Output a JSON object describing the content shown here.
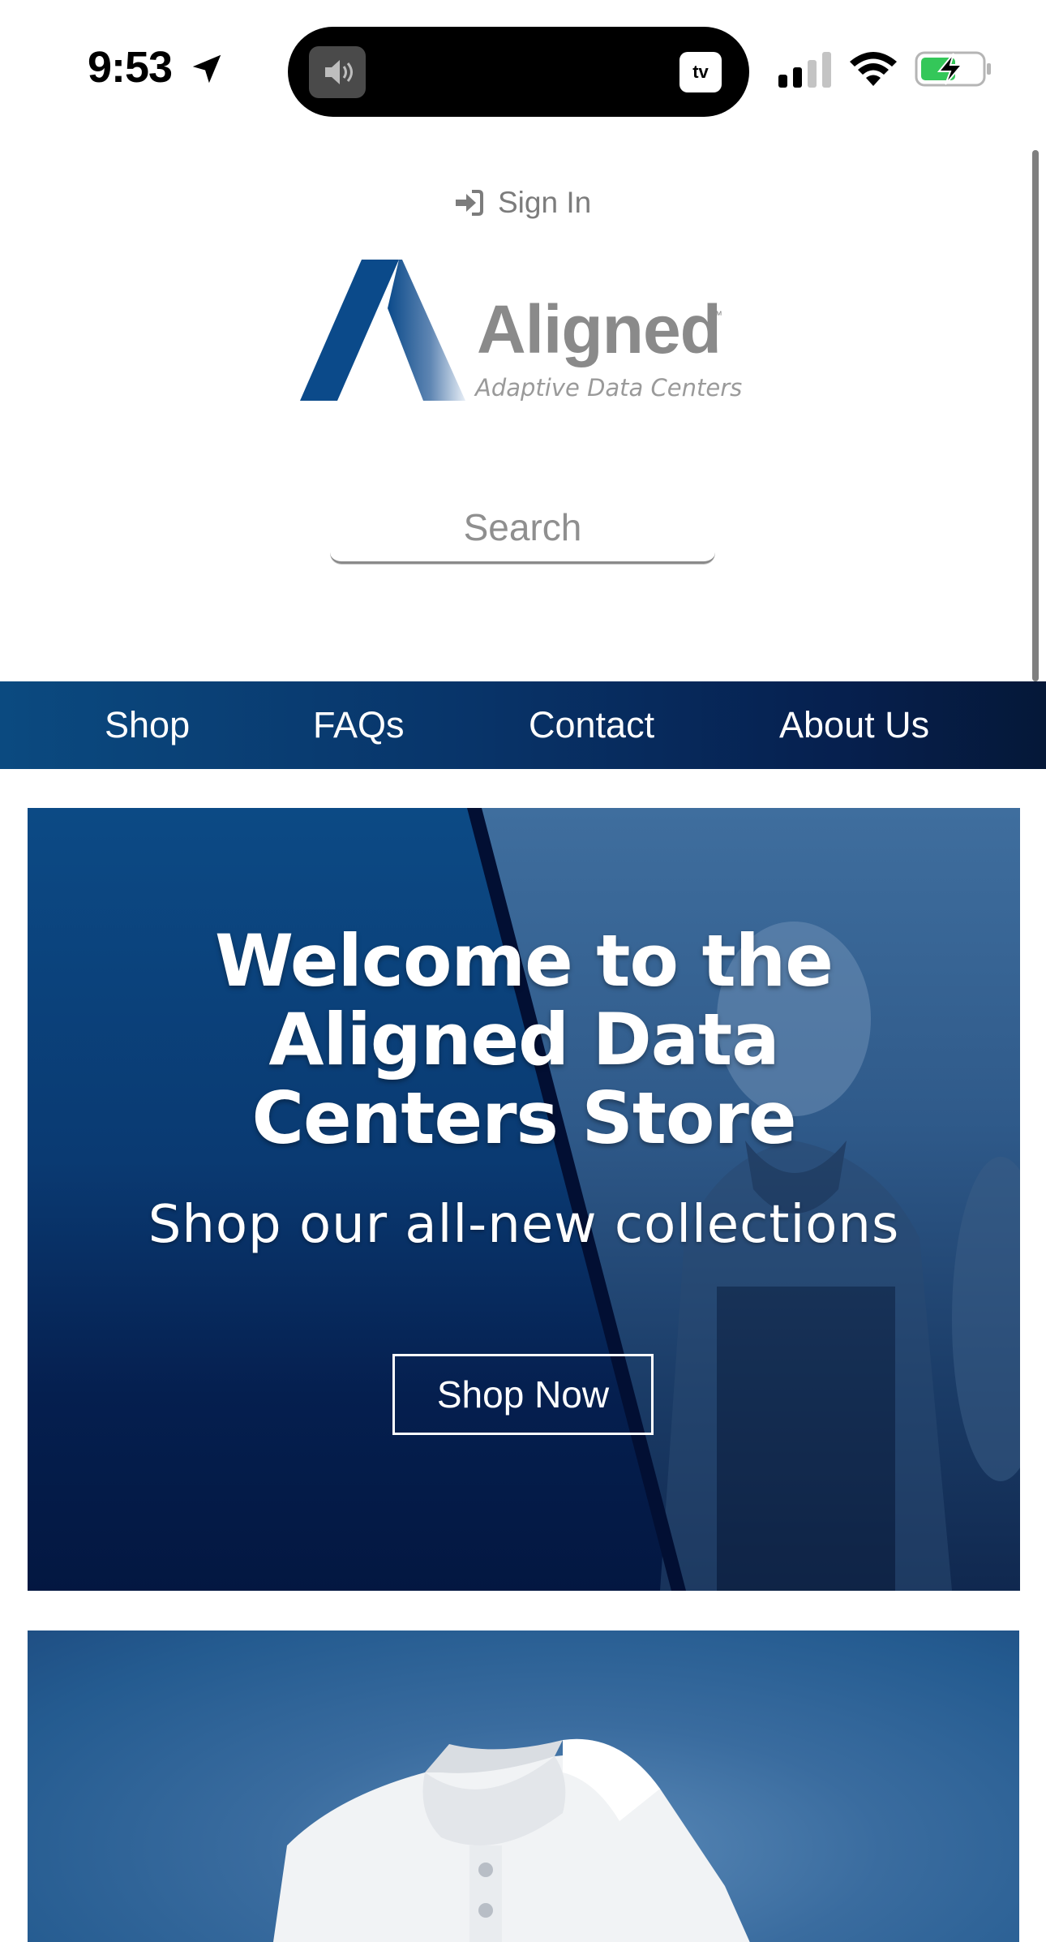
{
  "status_bar": {
    "time": "9:53",
    "tv_label": "tv",
    "battery_state": "charging"
  },
  "header": {
    "sign_in_label": "Sign In",
    "logo": {
      "name": "Aligned",
      "trademark": "™",
      "tagline": "Adaptive Data Centers",
      "brand_blue": "#0b4a8a"
    },
    "search": {
      "placeholder": "Search",
      "value": ""
    }
  },
  "nav": {
    "items": [
      {
        "label": "Shop"
      },
      {
        "label": "FAQs"
      },
      {
        "label": "Contact"
      },
      {
        "label": "About Us"
      }
    ],
    "background": "#083469"
  },
  "hero": {
    "title": "Welcome to the Aligned Data Centers Store",
    "subtitle": "Shop our all-new collections",
    "cta_label": "Shop Now"
  },
  "promo": {
    "image_subject": "white-polo-shirt"
  }
}
